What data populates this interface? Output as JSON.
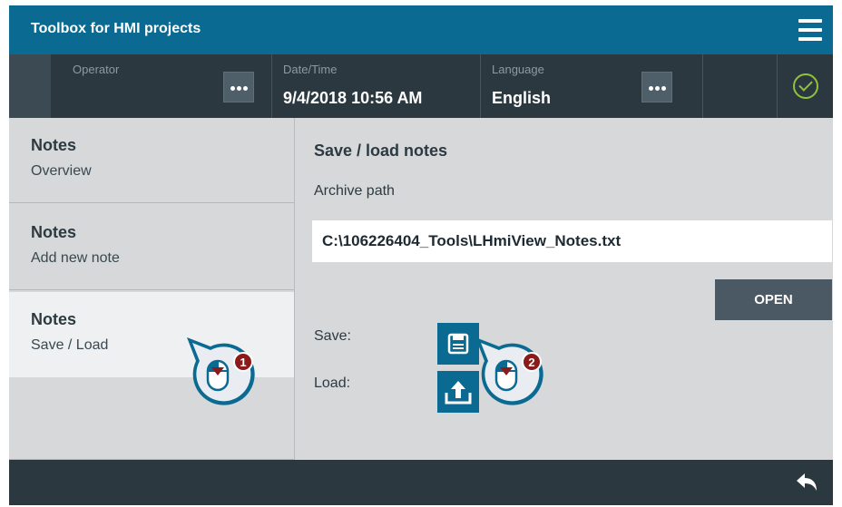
{
  "app": {
    "title": "Toolbox for HMI projects",
    "menu_icon": "hamburger-menu-icon"
  },
  "status_bar": {
    "operator_caption": "Operator",
    "operator_value": "",
    "datetime_caption": "Date/Time",
    "datetime_value": "9/4/2018 10:56 AM",
    "language_caption": "Language",
    "language_value": "English",
    "status_icon": "check-circle-icon",
    "status_color": "#8fc33e"
  },
  "nav": {
    "items": [
      {
        "title": "Notes",
        "subtitle": "Overview",
        "active": false
      },
      {
        "title": "Notes",
        "subtitle": "Add new note",
        "active": false
      },
      {
        "title": "Notes",
        "subtitle": "Save / Load",
        "active": true
      }
    ]
  },
  "main": {
    "title": "Save / load notes",
    "archive_label": "Archive path",
    "archive_path": "C:\\106226404_Tools\\LHmiView_Notes.txt",
    "open_label": "OPEN",
    "save_label": "Save:",
    "load_label": "Load:",
    "save_icon": "floppy-disk-icon",
    "load_icon": "upload-icon"
  },
  "footer": {
    "back_icon": "back-arrow-icon"
  },
  "callouts": [
    {
      "number": "1",
      "target": "nav-item-save-load"
    },
    {
      "number": "2",
      "target": "save-button"
    }
  ],
  "colors": {
    "accent": "#0b6a92",
    "dark_bar": "#2c3840",
    "panel": "#d6d8da",
    "active_item": "#eef0f1",
    "callout_badge": "#8b1a1a"
  }
}
